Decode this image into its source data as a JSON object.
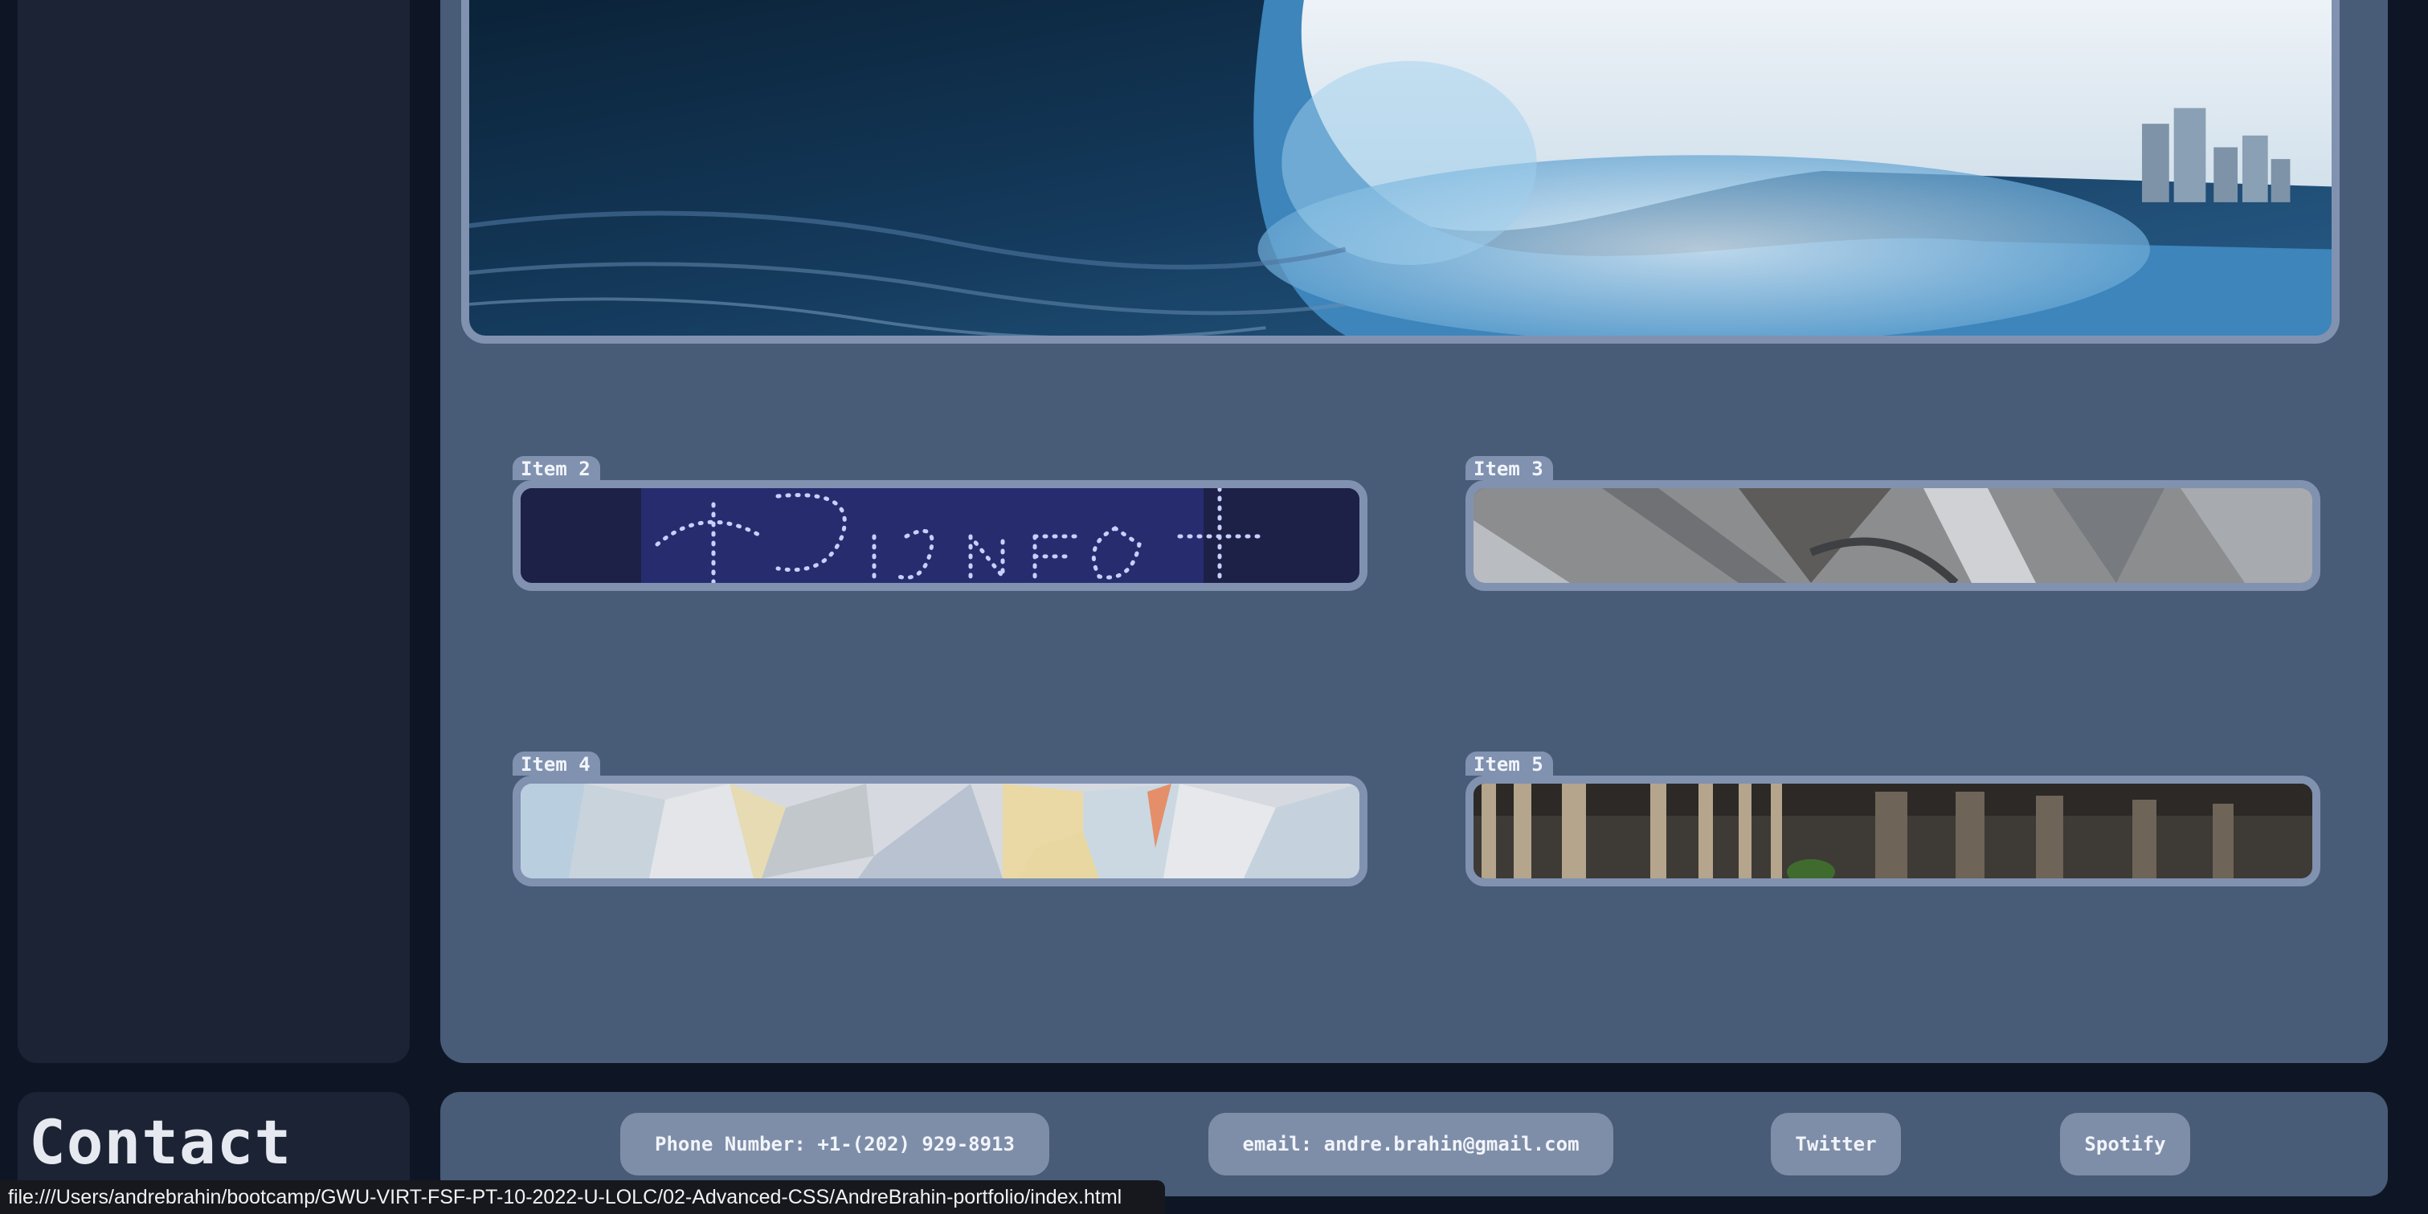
{
  "gallery": {
    "items": [
      {
        "label": "Item 2"
      },
      {
        "label": "Item 3"
      },
      {
        "label": "Item 4"
      },
      {
        "label": "Item 5"
      }
    ]
  },
  "contact": {
    "title": "Contact",
    "links": [
      {
        "label": "Phone Number: +1-(202) 929-8913"
      },
      {
        "label": "email: andre.brahin@gmail.com"
      },
      {
        "label": "Twitter"
      },
      {
        "label": "Spotify"
      }
    ]
  },
  "status_bar": {
    "url": "file:///Users/andrebrahin/bootcamp/GWU-VIRT-FSF-PT-10-2022-U-LOLC/02-Advanced-CSS/AndreBrahin-portfolio/index.html"
  },
  "colors": {
    "page_bg": "#0e1626",
    "panel_dark": "#1b2335",
    "panel_main": "#485b77",
    "frame": "#8092b0",
    "pill": "#7f8ea8"
  },
  "images": {
    "hero": "ocean-wave",
    "item2": "disney-plus-drone-show",
    "item3": "architecture",
    "item4": "low-poly-pattern",
    "item5": "columns"
  }
}
